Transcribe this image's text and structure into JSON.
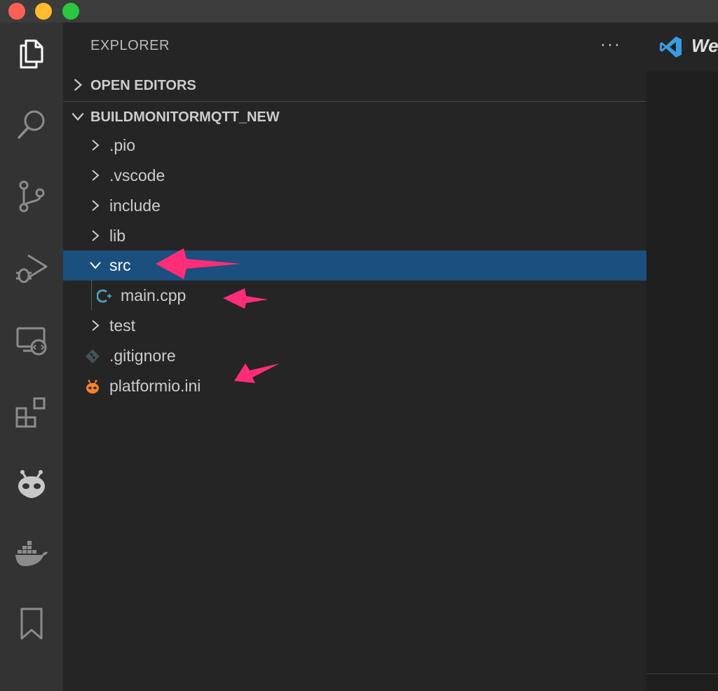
{
  "window": {
    "buttons": [
      "close",
      "minimize",
      "maximize"
    ]
  },
  "activity_bar": {
    "icons": [
      "files-icon",
      "search-icon",
      "source-control-icon",
      "run-debug-icon",
      "remote-explorer-icon",
      "extensions-icon",
      "platformio-icon",
      "docker-icon",
      "bookmarks-icon"
    ]
  },
  "sidebar": {
    "title": "EXPLORER",
    "more_actions": "···",
    "open_editors": "OPEN EDITORS",
    "project": "BUILDMONITORMQTT_NEW",
    "tree": [
      {
        "label": ".pio",
        "type": "folder"
      },
      {
        "label": ".vscode",
        "type": "folder"
      },
      {
        "label": "include",
        "type": "folder"
      },
      {
        "label": "lib",
        "type": "folder"
      },
      {
        "label": "src",
        "type": "folder-open"
      },
      {
        "label": "main.cpp",
        "type": "cpp-file"
      },
      {
        "label": "test",
        "type": "folder"
      },
      {
        "label": ".gitignore",
        "type": "git-file"
      },
      {
        "label": "platformio.ini",
        "type": "platformio-file"
      }
    ]
  },
  "editor": {
    "tab_label": "We"
  },
  "colors": {
    "selection": "#1a4f7e",
    "annotation_arrow": "#ff2d78",
    "vscode_logo": "#3a9ce0",
    "platformio": "#f5822a",
    "cpp_icon": "#519aba"
  }
}
